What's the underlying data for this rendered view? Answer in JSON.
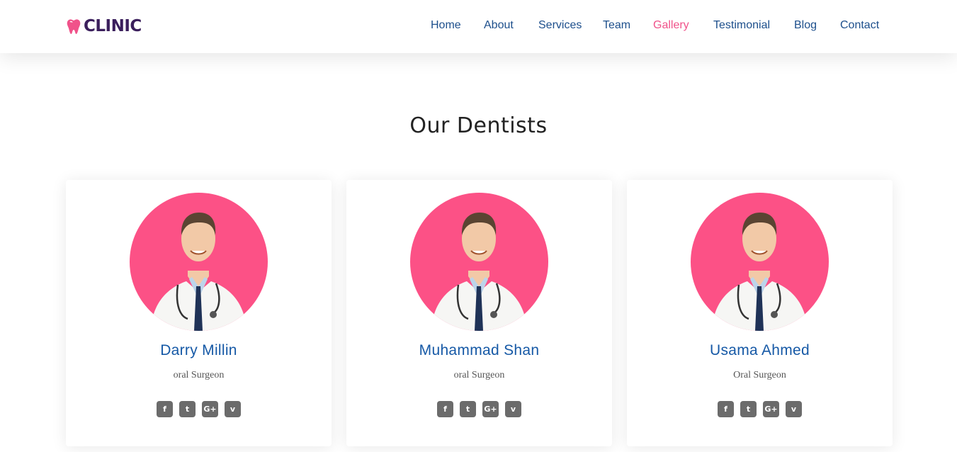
{
  "brand": {
    "name": "CLINIC",
    "logo_icon": "tooth-icon",
    "primary_color": "#3b1f5c",
    "accent_color": "#f0528a"
  },
  "nav": {
    "items": [
      {
        "label": "Home"
      },
      {
        "label": "About"
      },
      {
        "label": "Services"
      },
      {
        "label": "Team"
      },
      {
        "label": "Gallery",
        "active": true
      },
      {
        "label": "Testimonial"
      },
      {
        "label": "Blog"
      },
      {
        "label": "Contact"
      }
    ]
  },
  "section": {
    "title": "Our Dentists"
  },
  "dentists": [
    {
      "name": "Darry Millin",
      "role": "oral Surgeon",
      "photo": "doctor-portrait"
    },
    {
      "name": "Muhammad Shan",
      "role": "oral Surgeon",
      "photo": "doctor-portrait"
    },
    {
      "name": "Usama Ahmed",
      "role": "Oral Surgeon",
      "photo": "doctor-portrait"
    }
  ],
  "social_icons": {
    "facebook": "f",
    "twitter": "t",
    "google_plus": "G+",
    "vimeo": "v"
  },
  "colors": {
    "avatar_bg": "#fc5186",
    "name_text": "#1659a6",
    "nav_text": "#1d4f8c",
    "social_bg": "#6b6b6b"
  }
}
